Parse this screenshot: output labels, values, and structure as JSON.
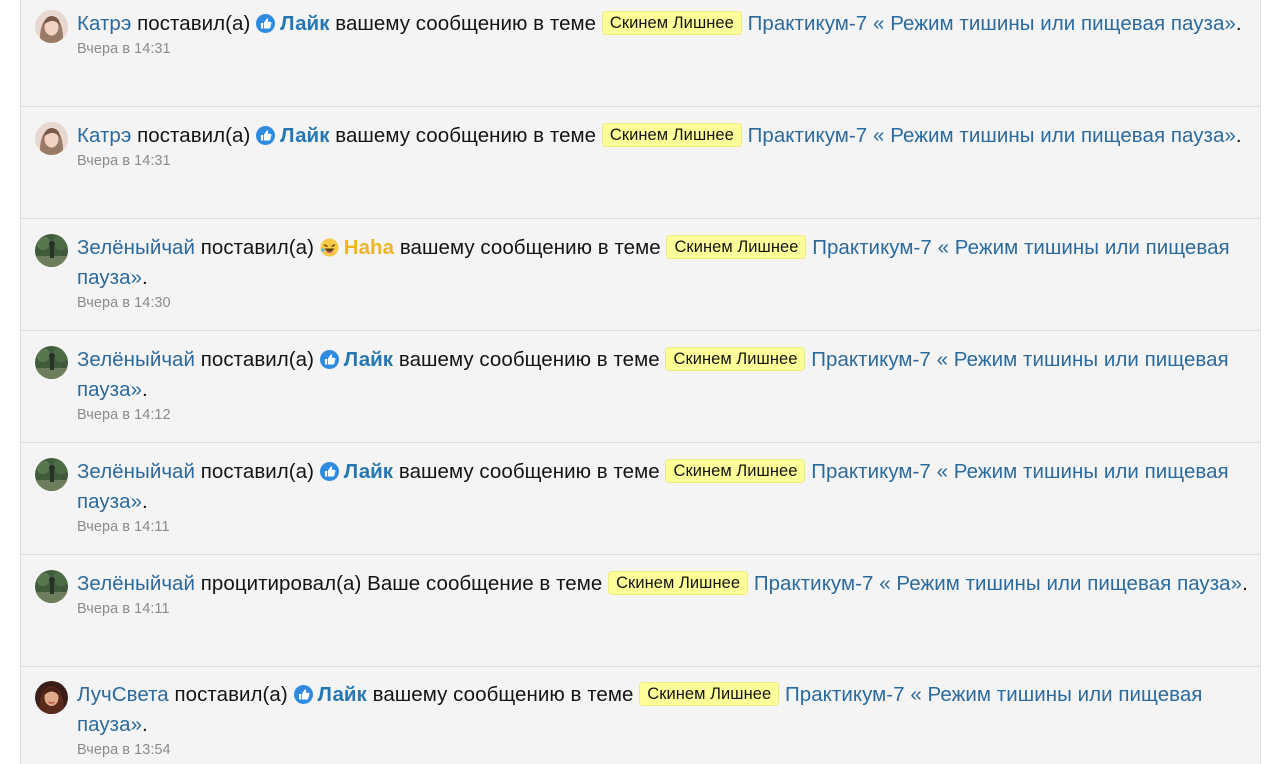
{
  "alerts": [
    {
      "username": "Катрэ",
      "avatar_icon": "avatar-katre",
      "action": "поставил(а)",
      "reaction_icon": "like-icon",
      "reaction_label": "Лайк",
      "reaction_color": "#2577b1",
      "middle": "вашему сообщению в теме",
      "prefix": "Скинем Лишнее",
      "thread": "Практикум-7 « Режим тишины или пищевая пауза»",
      "tail": ".",
      "time": "Вчера в 14:31"
    },
    {
      "username": "Катрэ",
      "avatar_icon": "avatar-katre",
      "action": "поставил(а)",
      "reaction_icon": "like-icon",
      "reaction_label": "Лайк",
      "reaction_color": "#2577b1",
      "middle": "вашему сообщению в теме",
      "prefix": "Скинем Лишнее",
      "thread": "Практикум-7 « Режим тишины или пищевая пауза»",
      "tail": ".",
      "time": "Вчера в 14:31"
    },
    {
      "username": "Зелёныйчай",
      "avatar_icon": "avatar-zelenyichai",
      "action": "поставил(а)",
      "reaction_icon": "haha-icon",
      "reaction_label": "Haha",
      "reaction_color": "#f0b429",
      "middle": "вашему сообщению в теме",
      "prefix": "Скинем Лишнее",
      "thread": "Практикум-7 « Режим тишины или пищевая пауза»",
      "tail": ".",
      "time": "Вчера в 14:30"
    },
    {
      "username": "Зелёныйчай",
      "avatar_icon": "avatar-zelenyichai",
      "action": "поставил(а)",
      "reaction_icon": "like-icon",
      "reaction_label": "Лайк",
      "reaction_color": "#2577b1",
      "middle": "вашему сообщению в теме",
      "prefix": "Скинем Лишнее",
      "thread": "Практикум-7 « Режим тишины или пищевая пауза»",
      "tail": ".",
      "time": "Вчера в 14:12"
    },
    {
      "username": "Зелёныйчай",
      "avatar_icon": "avatar-zelenyichai",
      "action": "поставил(а)",
      "reaction_icon": "like-icon",
      "reaction_label": "Лайк",
      "reaction_color": "#2577b1",
      "middle": "вашему сообщению в теме",
      "prefix": "Скинем Лишнее",
      "thread": "Практикум-7 « Режим тишины или пищевая пауза»",
      "tail": ".",
      "time": "Вчера в 14:11"
    },
    {
      "username": "Зелёныйчай",
      "avatar_icon": "avatar-zelenyichai",
      "action": "процитировал(а)",
      "middle": "Ваше сообщение в теме",
      "prefix": "Скинем Лишнее",
      "thread": "Практикум-7 « Режим тишины или пищевая пауза»",
      "tail": ".",
      "time": "Вчера в 14:11"
    },
    {
      "username": "ЛучСвета",
      "avatar_icon": "avatar-luchsveta",
      "action": "поставил(а)",
      "reaction_icon": "like-icon",
      "reaction_label": "Лайк",
      "reaction_color": "#2577b1",
      "middle": "вашему сообщению в теме",
      "prefix": "Скинем Лишнее",
      "thread": "Практикум-7 « Режим тишины или пищевая пауза»",
      "tail": ".",
      "time": "Вчера в 13:54"
    }
  ],
  "colors": {
    "link": "#2b6a9c",
    "like": "#2577b1",
    "haha": "#f0b429",
    "prefix_bg": "#ffff99",
    "row_bg": "#f4f4f4",
    "timestamp": "#8b8b8b"
  }
}
